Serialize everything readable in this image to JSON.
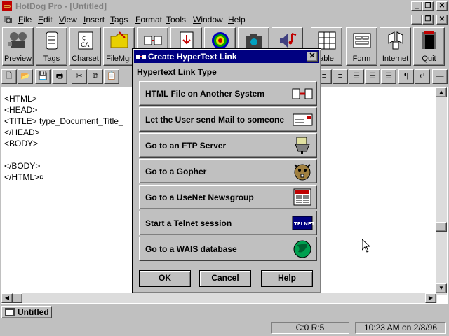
{
  "window": {
    "title": "HotDog Pro - [Untitled]"
  },
  "menu": [
    "File",
    "Edit",
    "View",
    "Insert",
    "Tags",
    "Format",
    "Tools",
    "Window",
    "Help"
  ],
  "toolbar": [
    {
      "label": "Preview",
      "icon": "projector-icon"
    },
    {
      "label": "Tags",
      "icon": "tags-icon"
    },
    {
      "label": "Charset",
      "icon": "charset-icon"
    },
    {
      "label": "FileMgr",
      "icon": "folder-icon"
    },
    {
      "label": "",
      "icon": "link-icon"
    },
    {
      "label": "",
      "icon": "download-icon"
    },
    {
      "label": "",
      "icon": "target-icon"
    },
    {
      "label": "",
      "icon": "camera-icon"
    },
    {
      "label": "",
      "icon": "sound-icon"
    },
    {
      "label": "able",
      "icon": "table-icon"
    },
    {
      "label": "Form",
      "icon": "form-icon"
    },
    {
      "label": "Internet",
      "icon": "internet-icon"
    },
    {
      "label": "Quit",
      "icon": "exit-icon"
    }
  ],
  "editor": {
    "code": "<HTML>\n<HEAD>\n<TITLE> type_Document_Title_\n</HEAD>\n<BODY>\n\n</BODY>\n</HTML>¤"
  },
  "dialog": {
    "title": "Create HyperText Link",
    "group_label": "Hypertext Link Type",
    "options": [
      {
        "label": "HTML File on Another System",
        "icon": "link-icon"
      },
      {
        "label": "Let the User send Mail to someone",
        "icon": "mail-icon"
      },
      {
        "label": "Go to an FTP Server",
        "icon": "ftp-icon"
      },
      {
        "label": "Go to a Gopher",
        "icon": "gopher-icon"
      },
      {
        "label": "Go to a UseNet Newsgroup",
        "icon": "news-icon"
      },
      {
        "label": "Start a Telnet session",
        "icon": "telnet-icon",
        "icon_text": "TELNET"
      },
      {
        "label": "Go to a WAIS database",
        "icon": "globe-icon"
      }
    ],
    "ok_label": "OK",
    "cancel_label": "Cancel",
    "help_label": "Help"
  },
  "tabs": {
    "document": "Untitled"
  },
  "status": {
    "position": "C:0 R:5",
    "datetime": "10:23 AM on 2/8/96"
  },
  "colors": {
    "dialog_title_bg": "#000080",
    "face": "#c0c0c0"
  }
}
